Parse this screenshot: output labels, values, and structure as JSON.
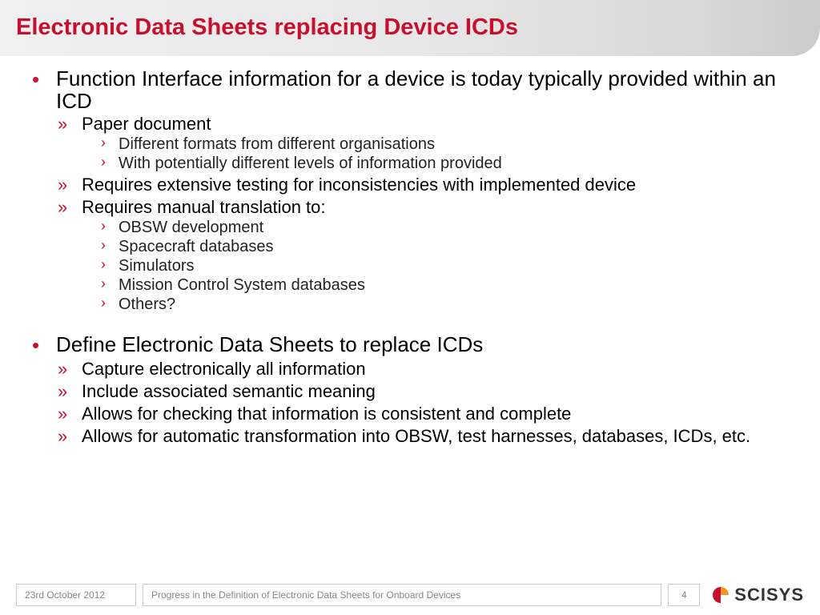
{
  "title": "Electronic Data Sheets replacing Device ICDs",
  "content": {
    "b1": {
      "text": "Function Interface information for a device is today typically provided within an ICD",
      "sub": {
        "s1": {
          "text": "Paper document",
          "sub": {
            "t1": "Different formats from different organisations",
            "t2": "With potentially different levels of information provided"
          }
        },
        "s2": {
          "text": "Requires extensive testing for inconsistencies with implemented device"
        },
        "s3": {
          "text": "Requires manual translation to:",
          "sub": {
            "t1": "OBSW development",
            "t2": "Spacecraft databases",
            "t3": "Simulators",
            "t4": "Mission Control System databases",
            "t5": "Others?"
          }
        }
      }
    },
    "b2": {
      "text": "Define Electronic Data Sheets to replace ICDs",
      "sub": {
        "s1": {
          "text": "Capture electronically all information"
        },
        "s2": {
          "text": "Include associated semantic meaning"
        },
        "s3": {
          "text": "Allows for checking that information is consistent and complete"
        },
        "s4": {
          "text": "Allows for automatic transformation into OBSW, test harnesses, databases, ICDs, etc."
        }
      }
    }
  },
  "footer": {
    "date": "23rd October 2012",
    "subtitle": "Progress in the Definition of Electronic Data Sheets for Onboard Devices",
    "page": "4",
    "logo": "SCISYS"
  }
}
